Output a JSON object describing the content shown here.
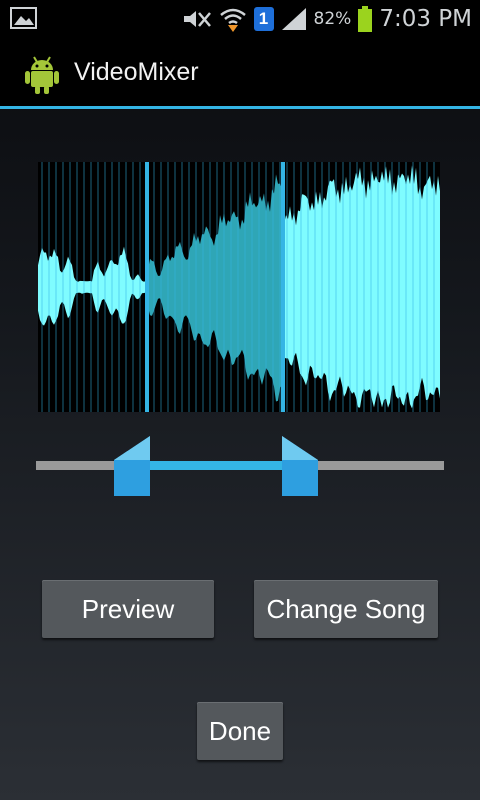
{
  "status_bar": {
    "time": "7:03 PM",
    "battery_percent": "82%",
    "notification_badge": "1",
    "icons": [
      "gallery-icon",
      "mute-icon",
      "wifi-icon",
      "sim-badge-icon",
      "signal-icon",
      "battery-icon"
    ]
  },
  "action_bar": {
    "title": "VideoMixer",
    "icon": "android-icon"
  },
  "trim_selection": {
    "start_fraction": 0.27,
    "end_fraction": 0.61
  },
  "buttons": {
    "preview": "Preview",
    "change_song": "Change Song",
    "done": "Done"
  },
  "colors": {
    "accent": "#34b5e5",
    "waveform": "#7ffcff",
    "waveform_selected": "#2fa6b6",
    "button_bg": "#54585c"
  }
}
